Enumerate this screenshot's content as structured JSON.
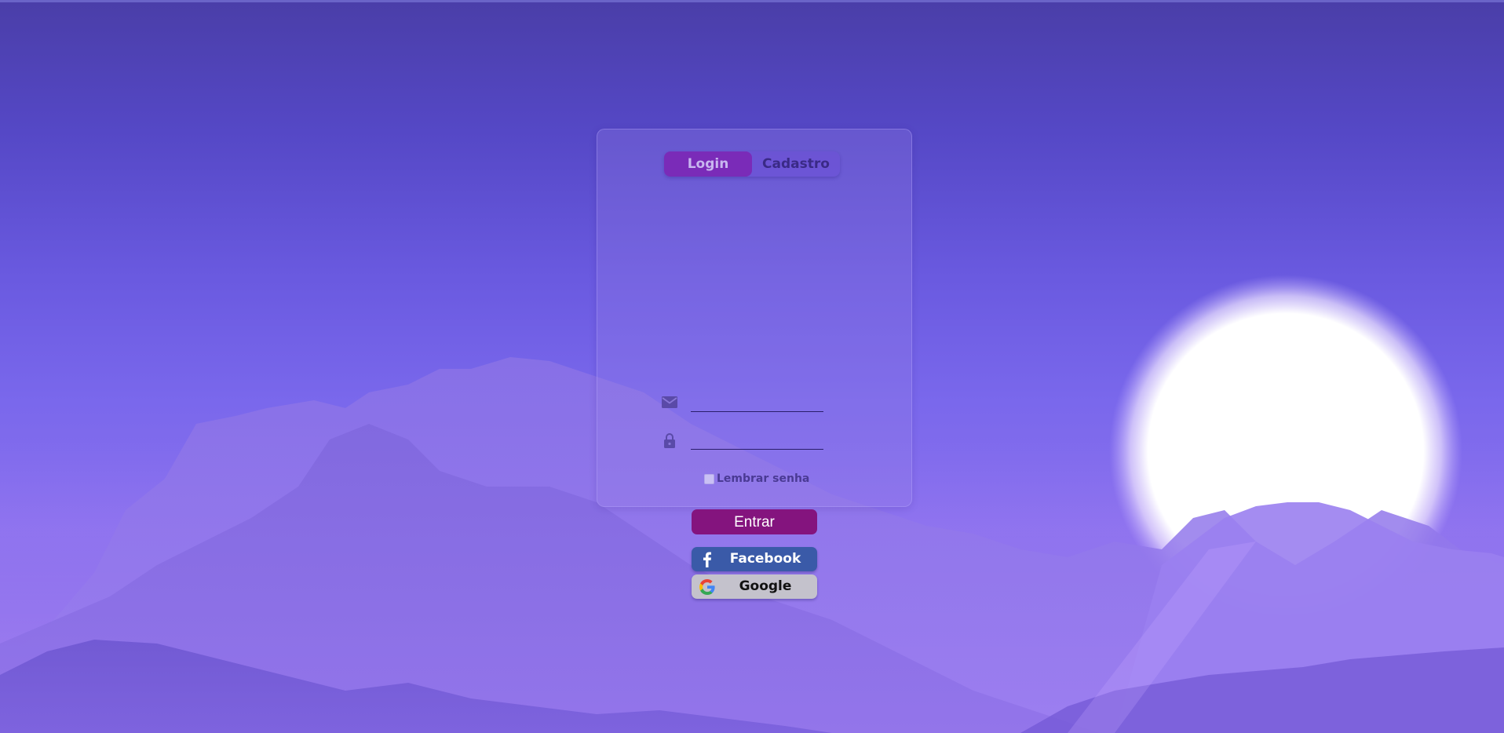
{
  "colors": {
    "accent": "#84147e",
    "tab_active": "#7a2bb8",
    "facebook": "#3a5aa8",
    "google": "#c4c2cc",
    "background_top": "#4a3ea8",
    "background_bottom": "#8a70ee"
  },
  "tabs": {
    "login_label": "Login",
    "cadastro_label": "Cadastro",
    "active": "Login"
  },
  "form": {
    "email": {
      "icon": "envelope-icon",
      "value": "",
      "placeholder": ""
    },
    "password": {
      "icon": "lock-icon",
      "value": "",
      "placeholder": ""
    },
    "remember_label": "Lembrar senha",
    "remember_checked": false,
    "submit_label": "Entrar"
  },
  "social": {
    "facebook_label": "Facebook",
    "facebook_icon": "facebook-icon",
    "google_label": "Google",
    "google_icon": "google-icon"
  }
}
